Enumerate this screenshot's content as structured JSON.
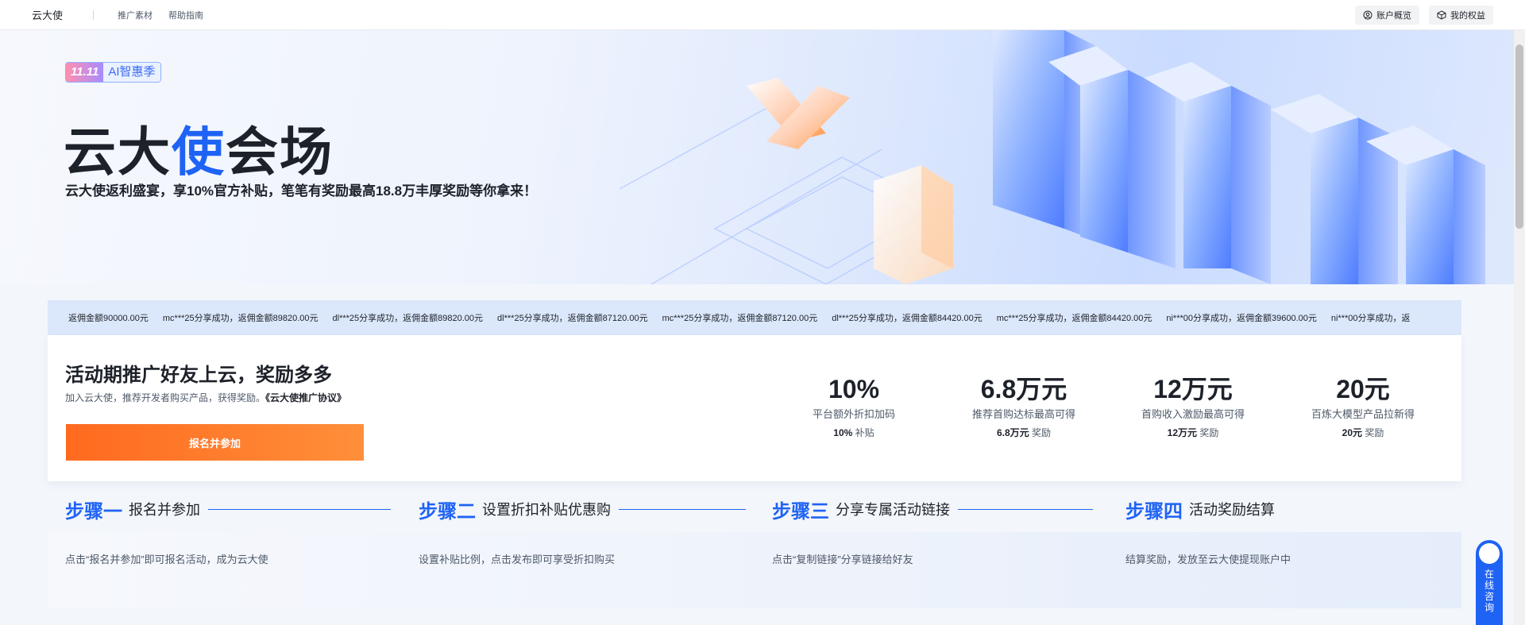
{
  "nav": {
    "brand": "云大使",
    "links": [
      "推广素材",
      "帮助指南"
    ],
    "account_overview": "账户概览",
    "my_benefits": "我的权益"
  },
  "hero": {
    "badge_left": "11.11",
    "badge_right": "AI智惠季",
    "title_part1": "云大",
    "title_accent": "使",
    "title_part2": "会场",
    "subtitle": "云大使返利盛宴，享10%官方补贴，笔笔有奖励最高18.8万丰厚奖励等你拿来！"
  },
  "ticker": [
    "返佣金额90000.00元",
    "mc***25分享成功，返佣金额89820.00元",
    "dl***25分享成功，返佣金额89820.00元",
    "dl***25分享成功，返佣金额87120.00元",
    "mc***25分享成功，返佣金额87120.00元",
    "dl***25分享成功，返佣金额84420.00元",
    "mc***25分享成功，返佣金额84420.00元",
    "ni***00分享成功，返佣金额39600.00元",
    "ni***00分享成功，返"
  ],
  "promo": {
    "title": "活动期推广好友上云，奖励多多",
    "desc": "加入云大使，推荐开发者购买产品，获得奖励。",
    "agreement": "《云大使推广协议》",
    "join_button": "报名并参加",
    "stats": [
      {
        "value": "10%",
        "desc": "平台额外折扣加码",
        "sub_bold": "10%",
        "sub_text": "补贴"
      },
      {
        "value": "6.8万元",
        "desc": "推荐首购达标最高可得",
        "sub_bold": "6.8万元",
        "sub_text": "奖励"
      },
      {
        "value": "12万元",
        "desc": "首购收入激励最高可得",
        "sub_bold": "12万元",
        "sub_text": "奖励"
      },
      {
        "value": "20元",
        "desc": "百炼大模型产品拉新得",
        "sub_bold": "20元",
        "sub_text": "奖励"
      }
    ]
  },
  "steps": [
    {
      "num": "步骤一",
      "name": "报名并参加",
      "desc": "点击“报名并参加”即可报名活动，成为云大使"
    },
    {
      "num": "步骤二",
      "name": "设置折扣补贴优惠购",
      "desc": "设置补贴比例，点击发布即可享受折扣购买"
    },
    {
      "num": "步骤三",
      "name": "分享专属活动链接",
      "desc": "点击“复制链接”分享链接给好友"
    },
    {
      "num": "步骤四",
      "name": "活动奖励结算",
      "desc": "结算奖励，发放至云大使提现账户中"
    }
  ],
  "chat": {
    "label": "在线咨询"
  },
  "colors": {
    "accent": "#1f63f5",
    "cta": "#ff6a1f"
  }
}
